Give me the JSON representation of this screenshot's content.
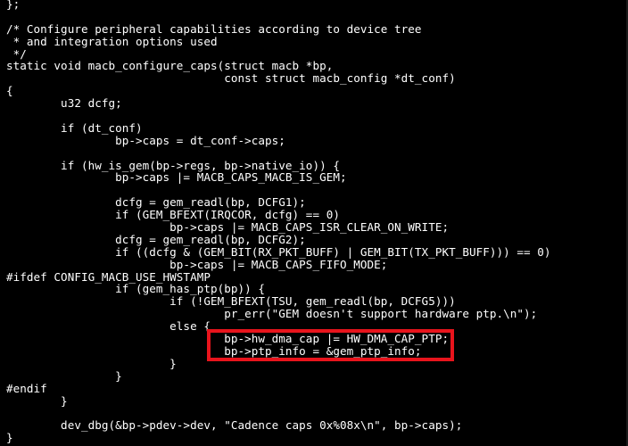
{
  "editor": {
    "lines": [
      "};",
      "",
      "/* Configure peripheral capabilities according to device tree",
      " * and integration options used",
      " */",
      "static void macb_configure_caps(struct macb *bp,",
      "                                const struct macb_config *dt_conf)",
      "{",
      "        u32 dcfg;",
      "",
      "        if (dt_conf)",
      "                bp->caps = dt_conf->caps;",
      "",
      "        if (hw_is_gem(bp->regs, bp->native_io)) {",
      "                bp->caps |= MACB_CAPS_MACB_IS_GEM;",
      "",
      "                dcfg = gem_readl(bp, DCFG1);",
      "                if (GEM_BFEXT(IRQCOR, dcfg) == 0)",
      "                        bp->caps |= MACB_CAPS_ISR_CLEAR_ON_WRITE;",
      "                dcfg = gem_readl(bp, DCFG2);",
      "                if ((dcfg & (GEM_BIT(RX_PKT_BUFF) | GEM_BIT(TX_PKT_BUFF))) == 0)",
      "                        bp->caps |= MACB_CAPS_FIFO_MODE;",
      "#ifdef CONFIG_MACB_USE_HWSTAMP",
      "                if (gem_has_ptp(bp)) {",
      "                        if (!GEM_BFEXT(TSU, gem_readl(bp, DCFG5)))",
      "                                pr_err(\"GEM doesn't support hardware ptp.\\n\");",
      "                        else {",
      "                                bp->hw_dma_cap |= HW_DMA_CAP_PTP;",
      "                                bp->ptp_info = &gem_ptp_info;",
      "                        }",
      "                }",
      "#endif",
      "        }",
      "",
      "        dev_dbg(&bp->pdev->dev, \"Cadence caps 0x%08x\\n\", bp->caps);",
      "}"
    ]
  },
  "colors": {
    "background": "#000000",
    "text": "#ffffff",
    "highlight": "#e8141c"
  }
}
